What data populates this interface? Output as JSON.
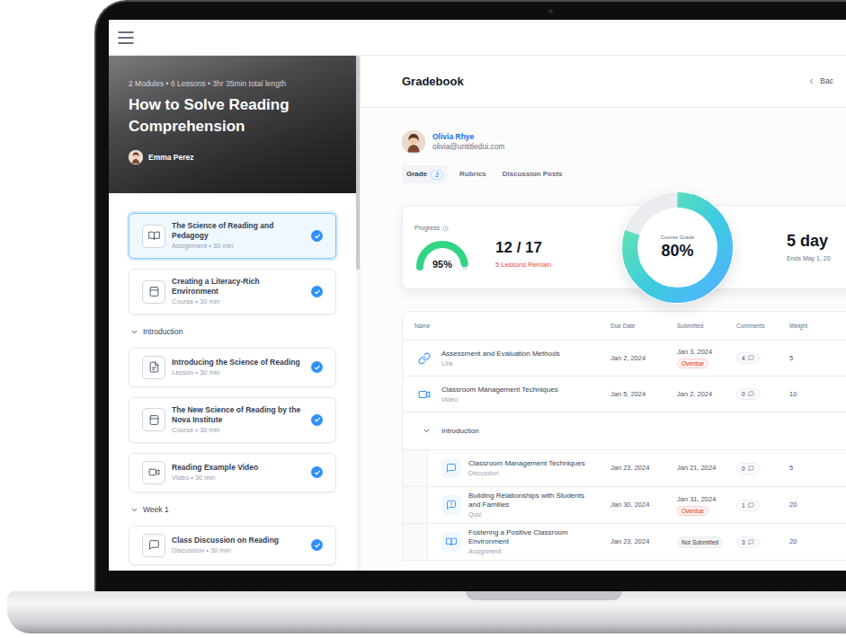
{
  "course": {
    "meta": "2 Modules • 6 Lessons • 3hr 35min total length",
    "title": "How to Solve Reading Comprehension",
    "author": "Emma Perez"
  },
  "outline": [
    {
      "section": null,
      "lessons": [
        {
          "kind": "assignment",
          "title": "The Science of Reading and Pedagogy",
          "subtitle": "Assignment • 30 min",
          "completed": true,
          "selected": true
        },
        {
          "kind": "course",
          "title": "Creating a Literacy-Rich Environment",
          "subtitle": "Course • 30 min",
          "completed": true,
          "selected": false
        }
      ]
    },
    {
      "section": {
        "title": "Introduction",
        "expanded": true
      },
      "lessons": [
        {
          "kind": "lesson",
          "title": "Introducing the Science of Reading",
          "subtitle": "Lesson • 30 min",
          "completed": true,
          "selected": false
        },
        {
          "kind": "course",
          "title": "The New Science of Reading by the Nova Institute",
          "subtitle": "Course • 30 min",
          "completed": true,
          "selected": false
        },
        {
          "kind": "video",
          "title": "Reading Example Video",
          "subtitle": "Video • 30 min",
          "completed": true,
          "selected": false
        }
      ]
    },
    {
      "section": {
        "title": "Week 1",
        "expanded": true
      },
      "lessons": [
        {
          "kind": "discussion",
          "title": "Class Discussion on Reading",
          "subtitle": "Discussion • 30 min",
          "completed": true,
          "selected": false
        }
      ]
    }
  ],
  "gradebook": {
    "title": "Gradebook",
    "back": "Bac"
  },
  "student": {
    "name": "Olivia Rhye",
    "email": "olivia@untitledui.com"
  },
  "tabs": [
    {
      "label": "Grade",
      "badge": "2",
      "selected": true
    },
    {
      "label": "Rubrics",
      "selected": false
    },
    {
      "label": "Discussion Posts",
      "selected": false
    }
  ],
  "stats": {
    "progress_label": "Progress",
    "progress_percent": "95%",
    "progress_level": 0.95,
    "lessons_done": "12 / 17",
    "lessons_remain": "5 Lessons Remain",
    "grade_label": "Course Grade",
    "grade": "80%",
    "grade_level": 0.8,
    "days": "5 day",
    "ends": "Ends May 1, 20"
  },
  "table": {
    "columns": [
      "Name",
      "Due Date",
      "Submitted",
      "Comments",
      "Weight"
    ],
    "groups": [
      {
        "section": null,
        "rows": [
          {
            "kind": "link",
            "title": "Assessment and Evaluation Methods",
            "type": "Link",
            "due": "Jan 2, 2024",
            "submitted": "Jan 3, 2024",
            "status": {
              "text": "Overdue",
              "kind": "overdue"
            },
            "comments": "4",
            "weight": "5"
          },
          {
            "kind": "video",
            "title": "Classroom Management Techniques",
            "type": "Video",
            "due": "Jan 5, 2024",
            "submitted": "Jan 2, 2024",
            "status": null,
            "comments": "0",
            "weight": "10"
          }
        ]
      },
      {
        "section": {
          "title": "Introduction",
          "expanded": true
        },
        "rows": [
          {
            "kind": "discussion",
            "title": "Classroom Management Techniques",
            "type": "Discussion",
            "due": "Jan 23, 2024",
            "submitted": "Jan 21, 2024",
            "status": null,
            "comments": "0",
            "weight": "5"
          },
          {
            "kind": "quiz",
            "title": "Building Relationships with Students and Families",
            "type": "Quiz",
            "due": "Jan 30, 2024",
            "submitted": "Jan 31, 2024",
            "status": {
              "text": "Overdue",
              "kind": "overdue"
            },
            "comments": "1",
            "weight": "20"
          },
          {
            "kind": "assignment",
            "title": "Fostering a Positive Classroom Environment",
            "type": "Assignment",
            "due": "Jan 23, 2024",
            "submitted": null,
            "status": {
              "text": "Not Submitted",
              "kind": "missing"
            },
            "comments": "3",
            "weight": "20"
          }
        ]
      }
    ]
  }
}
